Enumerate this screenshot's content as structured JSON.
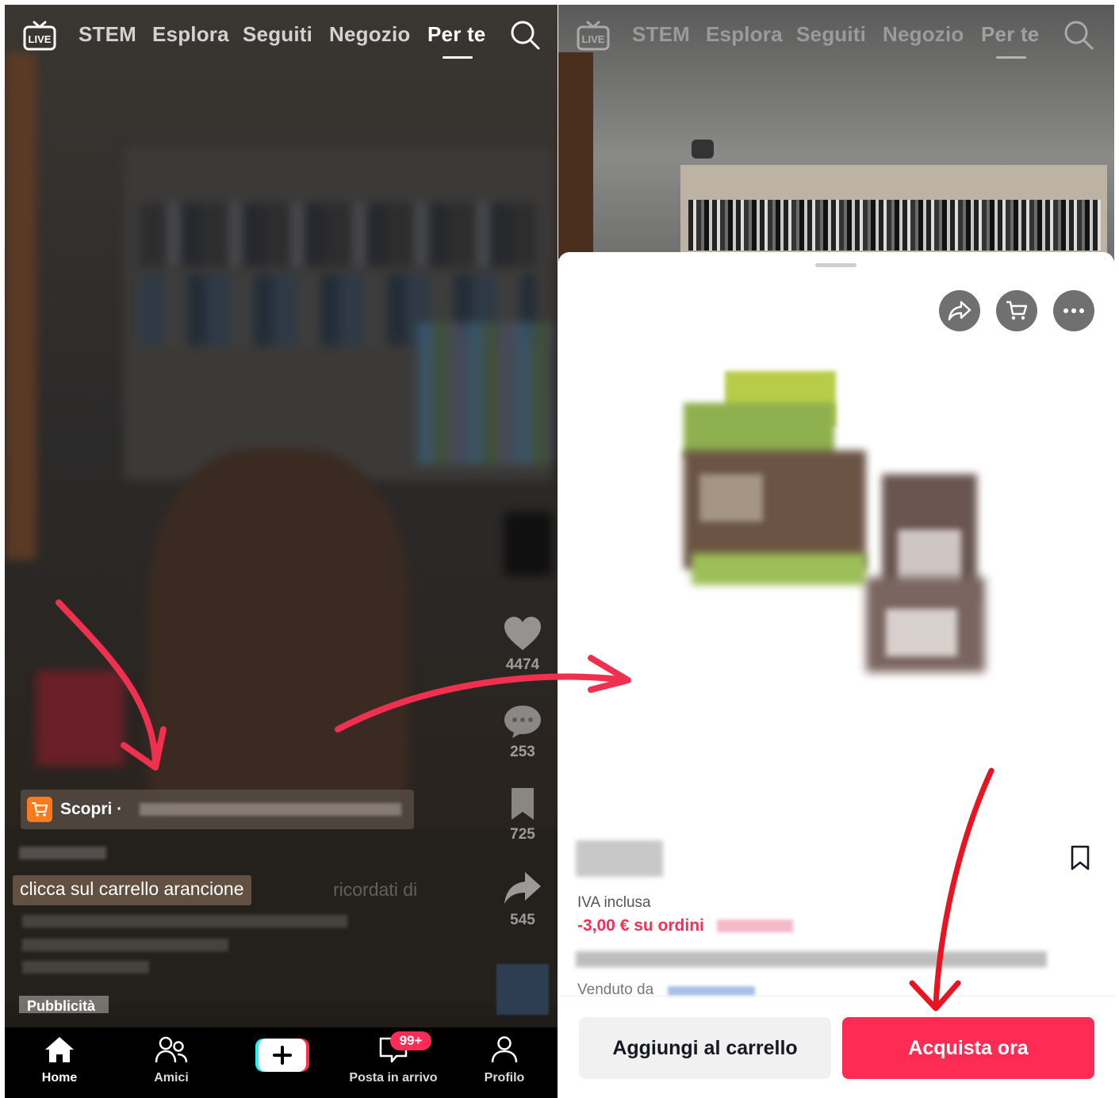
{
  "left_screen": {
    "top_nav": {
      "live_icon_text": "LIVE",
      "tabs": [
        {
          "label": "STEM"
        },
        {
          "label": "Esplora"
        },
        {
          "label": "Seguiti"
        },
        {
          "label": "Negozio"
        },
        {
          "label": "Per te",
          "active": true
        }
      ]
    },
    "side_actions": {
      "likes": "4474",
      "comments": "253",
      "saves": "725",
      "shares": "545"
    },
    "shop_banner": {
      "label": "Scopri ·",
      "badge_color": "#ff7a1a"
    },
    "caption": "clicca sul carrello arancione",
    "caption_faded": "ricordati di",
    "ad_label": "Pubblicità",
    "bottom_nav": {
      "items": [
        {
          "label": "Home",
          "icon": "home-icon"
        },
        {
          "label": "Amici",
          "icon": "friends-icon"
        },
        {
          "label": "",
          "icon": "plus-icon"
        },
        {
          "label": "Posta in arrivo",
          "icon": "inbox-icon"
        },
        {
          "label": "Profilo",
          "icon": "profile-icon"
        }
      ],
      "inbox_badge": "99+"
    }
  },
  "right_screen": {
    "top_nav": {
      "live_icon_text": "LIVE",
      "tabs": [
        {
          "label": "STEM"
        },
        {
          "label": "Esplora"
        },
        {
          "label": "Seguiti"
        },
        {
          "label": "Negozio"
        },
        {
          "label": "Per te",
          "active": true
        }
      ]
    },
    "sheet": {
      "actions": [
        "share-icon",
        "cart-icon",
        "more-icon"
      ],
      "vat": "IVA inclusa",
      "discount": "-3,00 € su ordini",
      "seller_label": "Venduto da",
      "add_to_cart": "Aggiungi al carrello",
      "buy_now": "Acquista ora"
    }
  },
  "colors": {
    "accent": "#fe2c55",
    "annotation_arrow": "#f0304f",
    "annotation_arrow_right": "#e8141f"
  }
}
